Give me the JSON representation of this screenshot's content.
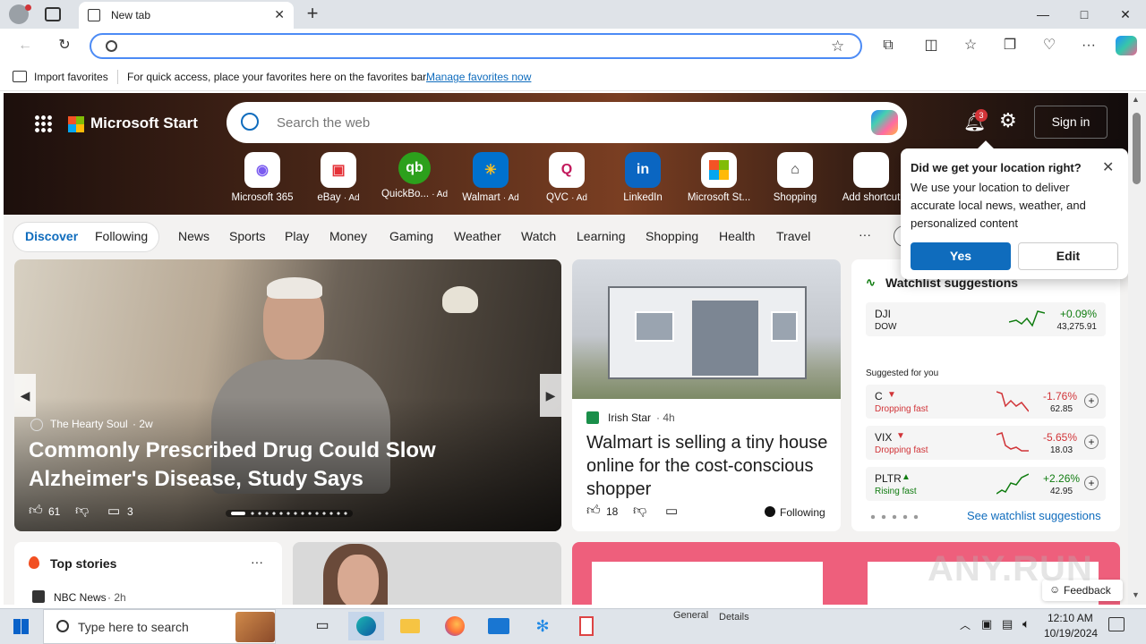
{
  "browser": {
    "tab_title": "New tab",
    "close_tab": "✕",
    "new_tab": "+",
    "window_min": "—",
    "window_max": "□",
    "window_close": "✕"
  },
  "favbar": {
    "import_label": "Import favorites",
    "hint": "For quick access, place your favorites here on the favorites bar.",
    "manage_link": "Manage favorites now"
  },
  "start": {
    "brand": "Microsoft Start",
    "search_placeholder": "Search the web",
    "notification_count": "3",
    "sign_in": "Sign in",
    "quick_links": [
      {
        "label": "Microsoft 365",
        "ad": ""
      },
      {
        "label": "eBay",
        "ad": "· Ad"
      },
      {
        "label": "QuickBo...",
        "ad": "· Ad"
      },
      {
        "label": "Walmart",
        "ad": "· Ad"
      },
      {
        "label": "QVC",
        "ad": "· Ad"
      },
      {
        "label": "LinkedIn",
        "ad": ""
      },
      {
        "label": "Microsoft St...",
        "ad": ""
      },
      {
        "label": "Shopping",
        "ad": ""
      },
      {
        "label": "Add shortcut",
        "ad": ""
      }
    ],
    "nav": {
      "discover": "Discover",
      "following": "Following",
      "items": [
        "News",
        "Sports",
        "Play",
        "Money",
        "Gaming",
        "Weather",
        "Watch",
        "Learning",
        "Shopping",
        "Health",
        "Travel"
      ],
      "more": "···"
    }
  },
  "main_story": {
    "source": "The Hearty Soul",
    "age": "· 2w",
    "title": "Commonly Prescribed Drug Could Slow Alzheimer's Disease, Study Says",
    "likes": "61",
    "comments": "3"
  },
  "story2": {
    "source": "Irish Star",
    "age": "· 4h",
    "title": "Walmart is selling a tiny house online for the cost-conscious shopper",
    "likes": "18",
    "following": "Following"
  },
  "watchlist": {
    "title": "Watchlist suggestions",
    "dow": {
      "symbol": "DJI",
      "name": "DOW",
      "change": "+0.09%",
      "value": "43,275.91"
    },
    "suggested_label": "Suggested for you",
    "stocks": [
      {
        "symbol": "C",
        "status": "Dropping fast",
        "change": "-1.76%",
        "value": "62.85"
      },
      {
        "symbol": "VIX",
        "status": "Dropping fast",
        "change": "-5.65%",
        "value": "18.03"
      },
      {
        "symbol": "PLTR",
        "status": "Rising fast",
        "change": "+2.26%",
        "value": "42.95"
      }
    ],
    "see_more": "See watchlist suggestions"
  },
  "top_stories": {
    "title": "Top stories",
    "more": "···",
    "first_source": "NBC News",
    "first_age": "· 2h"
  },
  "feedback": "Feedback",
  "location_popup": {
    "title": "Did we get your location right?",
    "body": "We use your location to deliver accurate local news, weather, and personalized content",
    "yes": "Yes",
    "edit": "Edit"
  },
  "taskbar": {
    "search_placeholder": "Type here to search",
    "time": "12:10 AM",
    "date": "10/19/2024",
    "tab_general": "General",
    "tab_details": "Details"
  },
  "watermark": "ANY.RUN",
  "colors": {
    "accent": "#0f6cbd",
    "up": "#107c10",
    "down": "#d13438"
  }
}
